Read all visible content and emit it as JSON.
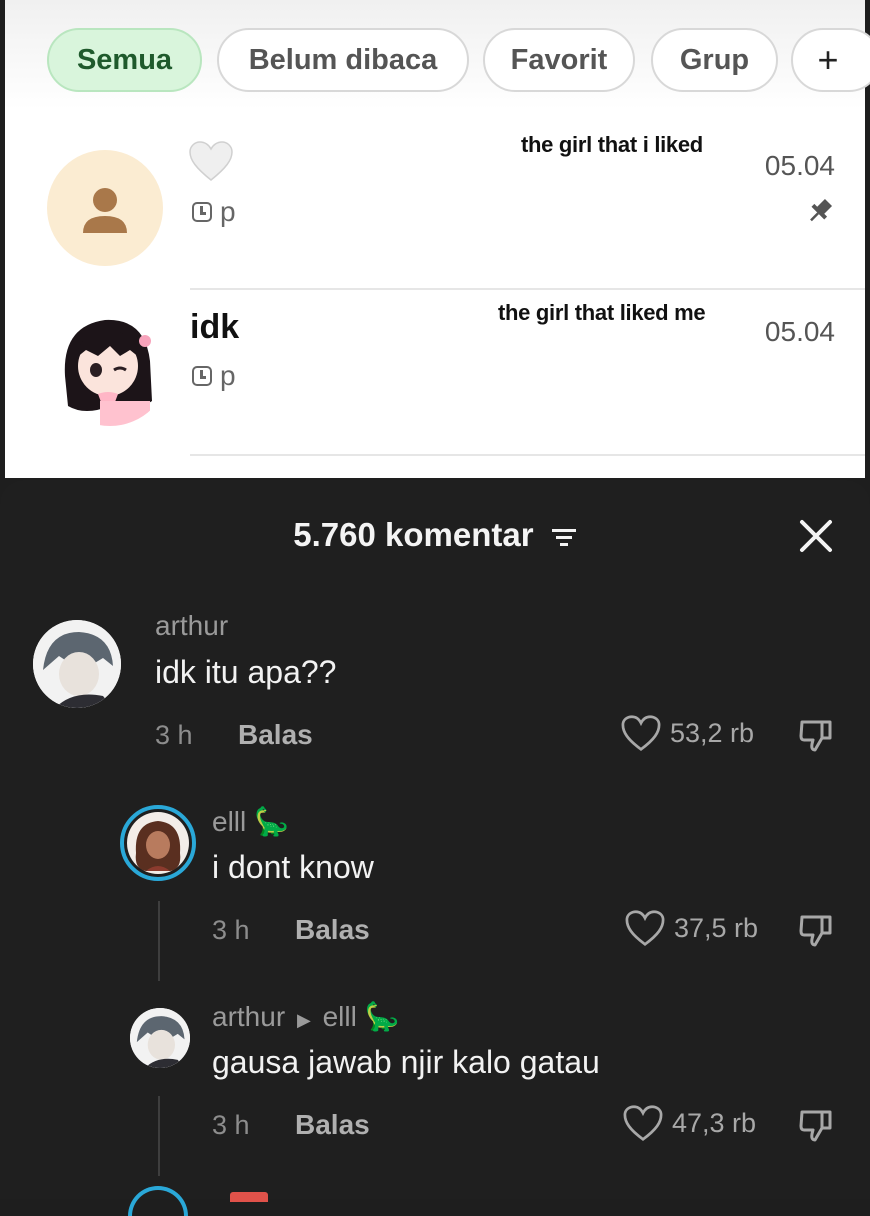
{
  "filters": [
    {
      "label": "Semua",
      "active": true
    },
    {
      "label": "Belum dibaca",
      "active": false
    },
    {
      "label": "Favorit",
      "active": false
    },
    {
      "label": "Grup",
      "active": false
    },
    {
      "label": "+",
      "active": false
    }
  ],
  "chats": [
    {
      "name": "",
      "heart": "heart-icon",
      "meta": "p",
      "time": "05.04",
      "pinned": true,
      "caption": "the girl that i liked"
    },
    {
      "name": "idk",
      "meta": "p",
      "time": "05.04",
      "pinned": false,
      "caption": "the girl that liked me"
    }
  ],
  "comments_panel": {
    "title": "5.760 komentar",
    "comments": [
      {
        "user": "arthur",
        "text": "idk itu apa??",
        "time": "3 h",
        "reply": "Balas",
        "likes": "53,2 rb"
      },
      {
        "user": "elll",
        "badge": "🦕",
        "text": "i dont know",
        "time": "3 h",
        "reply": "Balas",
        "likes": "37,5 rb"
      },
      {
        "user": "arthur",
        "reply_to": "elll",
        "badge": "🦕",
        "text": "gausa jawab njir kalo gatau",
        "time": "3 h",
        "reply": "Balas",
        "likes": "47,3 rb"
      }
    ]
  },
  "colors": {
    "active_chip": "#d9f5dc",
    "panel_bg": "#1f1f1f",
    "text_light": "#f2f2f2"
  }
}
